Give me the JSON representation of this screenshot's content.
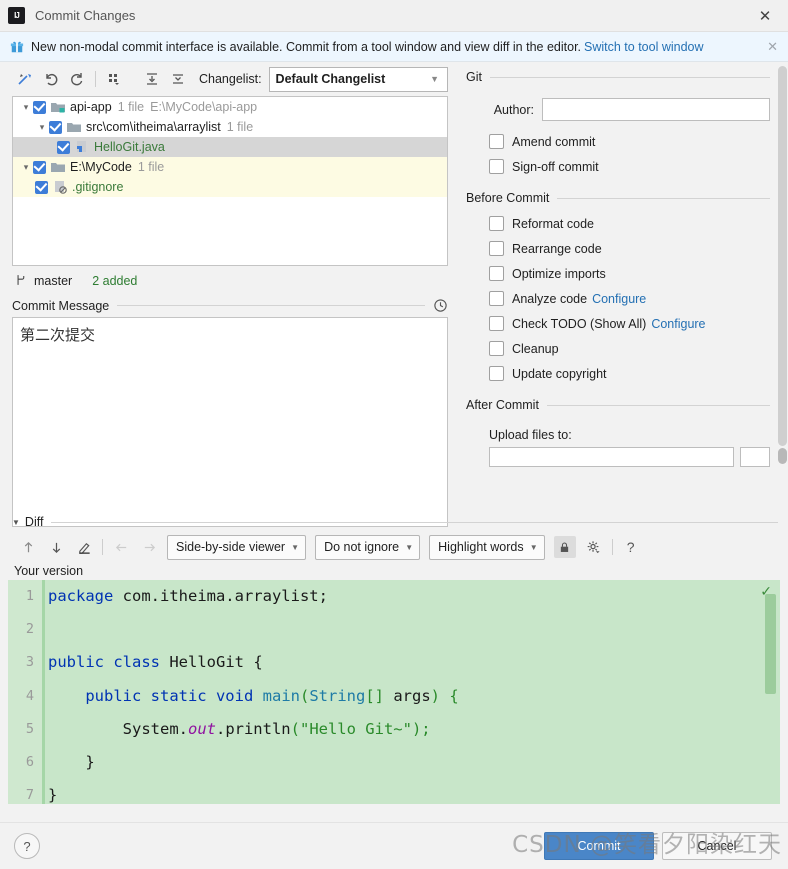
{
  "window": {
    "title": "Commit Changes",
    "logo_text": "IJ",
    "close_label": "✕"
  },
  "notification": {
    "icon": "gift-icon",
    "text": "New non-modal commit interface is available. Commit from a tool window and view diff in the editor.",
    "link": "Switch to tool window",
    "close_label": "✕"
  },
  "toolbar": {
    "items": [
      {
        "name": "show-diff-icon",
        "glyph": "↗"
      },
      {
        "name": "revert-icon",
        "glyph": "↺"
      },
      {
        "name": "refresh-icon",
        "glyph": "⟳"
      },
      {
        "name": "group-by-icon",
        "glyph": "∷"
      },
      {
        "name": "expand-all-icon",
        "glyph": "⤓"
      },
      {
        "name": "collapse-all-icon",
        "glyph": "⤒"
      }
    ],
    "changelist_label": "Changelist:",
    "changelist_value": "Default Changelist",
    "changelist_options": [
      "Default Changelist"
    ]
  },
  "tree": {
    "rows": [
      {
        "name": "tree-node-api-app",
        "indent": 0,
        "twisty": "⌄",
        "checked": true,
        "icon": "module-folder-icon",
        "label": "api-app",
        "meta1": "1 file",
        "meta2": "E:\\MyCode\\api-app",
        "state": "normal",
        "green": false
      },
      {
        "name": "tree-node-src-package",
        "indent": 1,
        "twisty": "⌄",
        "checked": true,
        "icon": "folder-icon",
        "label": "src\\com\\itheima\\arraylist",
        "meta1": "1 file",
        "meta2": "",
        "state": "normal",
        "green": false
      },
      {
        "name": "tree-node-hellogit-java",
        "indent": 2,
        "twisty": "",
        "checked": true,
        "icon": "java-file-icon",
        "label": "HelloGit.java",
        "meta1": "",
        "meta2": "",
        "state": "selected",
        "green": true
      },
      {
        "name": "tree-node-mycode-root",
        "indent": 0,
        "twisty": "⌄",
        "checked": true,
        "icon": "folder-icon",
        "label": "E:\\MyCode",
        "meta1": "1 file",
        "meta2": "",
        "state": "highlight",
        "green": false
      },
      {
        "name": "tree-node-gitignore",
        "indent": 1,
        "twisty": "",
        "checked": true,
        "icon": "gitignore-file-icon",
        "label": ".gitignore",
        "meta1": "",
        "meta2": "",
        "state": "highlight",
        "green": true
      }
    ]
  },
  "branch_bar": {
    "icon": "branch-icon",
    "branch": "master",
    "stats": "2 added"
  },
  "commit_message": {
    "label": "Commit Message",
    "history_icon": "clock-icon",
    "value": "第二次提交"
  },
  "git_panel": {
    "group_title": "Git",
    "author_label": "Author:",
    "author_value": "",
    "checkboxes": [
      {
        "name": "amend-commit-checkbox",
        "label": "Amend commit",
        "checked": false
      },
      {
        "name": "sign-off-commit-checkbox",
        "label": "Sign-off commit",
        "checked": false
      }
    ]
  },
  "before_commit": {
    "group_title": "Before Commit",
    "checkboxes": [
      {
        "name": "reformat-code-checkbox",
        "label": "Reformat code",
        "checked": false,
        "link": ""
      },
      {
        "name": "rearrange-code-checkbox",
        "label": "Rearrange code",
        "checked": false,
        "link": ""
      },
      {
        "name": "optimize-imports-checkbox",
        "label": "Optimize imports",
        "checked": false,
        "link": ""
      },
      {
        "name": "analyze-code-checkbox",
        "label": "Analyze code",
        "checked": false,
        "link": "Configure"
      },
      {
        "name": "check-todo-checkbox",
        "label": "Check TODO (Show All)",
        "checked": false,
        "link": "Configure"
      },
      {
        "name": "cleanup-checkbox",
        "label": "Cleanup",
        "checked": false,
        "link": ""
      },
      {
        "name": "update-copyright-checkbox",
        "label": "Update copyright",
        "checked": false,
        "link": ""
      }
    ]
  },
  "after_commit": {
    "group_title": "After Commit",
    "upload_label": "Upload files to:",
    "upload_value": "",
    "upload_button_label": ""
  },
  "diff": {
    "section_label": "Diff",
    "caret": "▼",
    "toolbar_icons": [
      {
        "name": "previous-difference-icon",
        "glyph": "↑",
        "dim": false
      },
      {
        "name": "next-difference-icon",
        "glyph": "↓",
        "dim": false
      },
      {
        "name": "edit-source-icon",
        "glyph": "✎",
        "dim": false
      },
      {
        "name": "apply-left-icon",
        "glyph": "←",
        "dim": true
      },
      {
        "name": "apply-right-icon",
        "glyph": "→",
        "dim": true
      }
    ],
    "viewer_mode": "Side-by-side viewer",
    "ignore_mode": "Do not ignore",
    "highlight_mode": "Highlight words",
    "lock_icon": "lock-icon",
    "settings_icon": "gear-icon",
    "help_icon": "question-icon",
    "pane_label": "Your version"
  },
  "code": {
    "lines": [
      {
        "num": "1",
        "tokens": [
          {
            "t": "package",
            "c": "k"
          },
          {
            "t": " com.itheima.arraylist;",
            "c": "id"
          }
        ]
      },
      {
        "num": "2",
        "tokens": []
      },
      {
        "num": "3",
        "tokens": [
          {
            "t": "public class",
            "c": "k"
          },
          {
            "t": " ",
            "c": "id"
          },
          {
            "t": "HelloGit",
            "c": "id"
          },
          {
            "t": " {",
            "c": "id"
          }
        ]
      },
      {
        "num": "4",
        "tokens": [
          {
            "t": "    ",
            "c": "id"
          },
          {
            "t": "public static void",
            "c": "k"
          },
          {
            "t": " ",
            "c": "id"
          },
          {
            "t": "main",
            "c": "cls"
          },
          {
            "t": "(",
            "c": "st"
          },
          {
            "t": "String",
            "c": "cls"
          },
          {
            "t": "[] ",
            "c": "st"
          },
          {
            "t": "args",
            "c": "id"
          },
          {
            "t": ") {",
            "c": "st"
          }
        ]
      },
      {
        "num": "5",
        "tokens": [
          {
            "t": "        System.",
            "c": "id"
          },
          {
            "t": "out",
            "c": "fld"
          },
          {
            "t": ".println",
            "c": "id"
          },
          {
            "t": "(",
            "c": "st"
          },
          {
            "t": "\"Hello Git~\"",
            "c": "st"
          },
          {
            "t": ");",
            "c": "st"
          }
        ]
      },
      {
        "num": "6",
        "tokens": [
          {
            "t": "    }",
            "c": "id"
          }
        ]
      },
      {
        "num": "7",
        "tokens": [
          {
            "t": "}",
            "c": "id"
          }
        ]
      }
    ],
    "accepted_icon": "checkmark-icon"
  },
  "footer": {
    "help_label": "?",
    "commit_label": "Commit",
    "cancel_label": "Cancel"
  },
  "watermark": {
    "text": "CSDN @笑看夕阳染红天"
  },
  "colors": {
    "accent_blue": "#3d7dd8",
    "link_blue": "#2470b3",
    "diff_added_bg": "#c8e6c9",
    "diff_gutter_bg": "#cfe8cf",
    "highlight_row": "#fdfbe3",
    "green_file_text": "#3a7a3a"
  }
}
